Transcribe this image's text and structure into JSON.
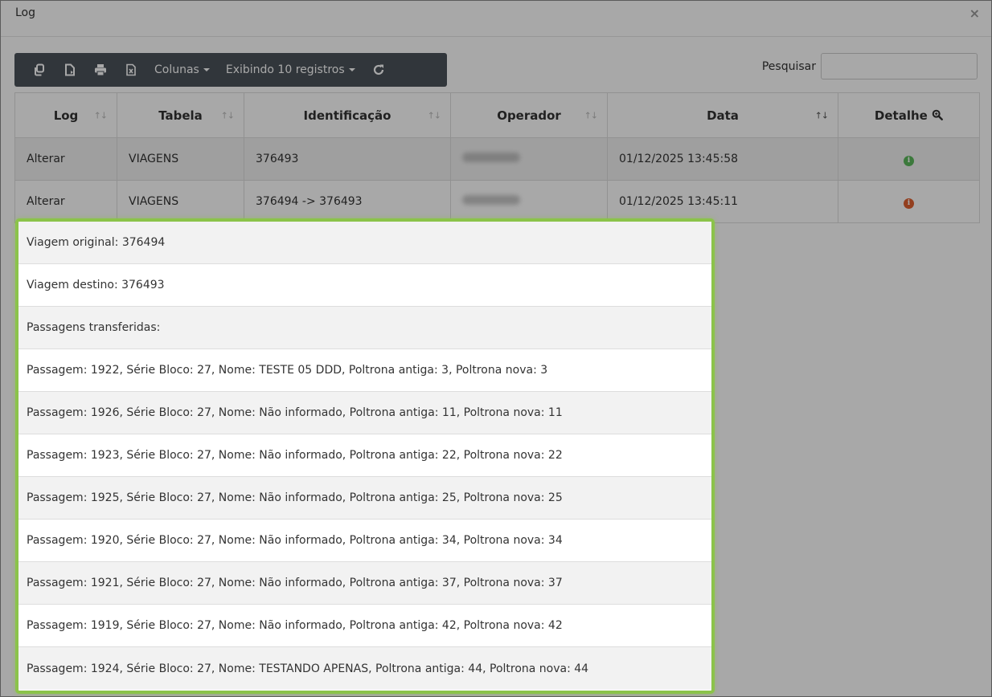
{
  "modal": {
    "title": "Log",
    "close": "×"
  },
  "toolbar": {
    "icons": [
      "copy-icon",
      "export-icon",
      "print-icon",
      "excel-icon"
    ],
    "columns_label": "Colunas",
    "records_label": "Exibindo 10 registros",
    "refresh_icon": "refresh-icon"
  },
  "search": {
    "label": "Pesquisar",
    "value": "",
    "placeholder": ""
  },
  "table": {
    "headers": [
      "Log",
      "Tabela",
      "Identificação",
      "Operador",
      "Data",
      "Detalhe"
    ],
    "rows": [
      {
        "log": "Alterar",
        "tabela": "VIAGENS",
        "identificacao": "376493",
        "operador": "",
        "data": "01/12/2025 13:45:58",
        "detalhe_color": "#5cb85c"
      },
      {
        "log": "Alterar",
        "tabela": "VIAGENS",
        "identificacao": "376494 -> 376493",
        "operador": "",
        "data": "01/12/2025 13:45:11",
        "detalhe_color": "#e06030"
      }
    ]
  },
  "detail": {
    "lines": [
      "Viagem original: 376494",
      "Viagem destino: 376493",
      "Passagens transferidas:",
      "Passagem: 1922, Série Bloco: 27, Nome: TESTE 05 DDD, Poltrona antiga: 3, Poltrona nova: 3",
      "Passagem: 1926, Série Bloco: 27, Nome: Não informado, Poltrona antiga: 11, Poltrona nova: 11",
      "Passagem: 1923, Série Bloco: 27, Nome: Não informado, Poltrona antiga: 22, Poltrona nova: 22",
      "Passagem: 1925, Série Bloco: 27, Nome: Não informado, Poltrona antiga: 25, Poltrona nova: 25",
      "Passagem: 1920, Série Bloco: 27, Nome: Não informado, Poltrona antiga: 34, Poltrona nova: 34",
      "Passagem: 1921, Série Bloco: 27, Nome: Não informado, Poltrona antiga: 37, Poltrona nova: 37",
      "Passagem: 1919, Série Bloco: 27, Nome: Não informado, Poltrona antiga: 42, Poltrona nova: 42",
      "Passagem: 1924, Série Bloco: 27, Nome: TESTANDO APENAS, Poltrona antiga: 44, Poltrona nova: 44"
    ]
  },
  "colors": {
    "toolbar_bg": "#4b525a",
    "popup_border": "#8bc34a"
  }
}
